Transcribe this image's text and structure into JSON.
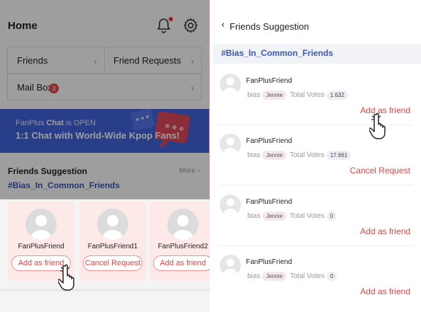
{
  "left": {
    "header": {
      "title": "Home",
      "bell_icon": "bell-icon",
      "settings_icon": "gear-icon"
    },
    "menu": {
      "friends": "Friends",
      "friend_requests": "Friend Requests",
      "mailbox": "Mail Box",
      "mailbox_badge": "3"
    },
    "banner": {
      "line1_prefix": "FanPlus ",
      "line1_bold": "Chat",
      "line1_suffix": " is OPEN",
      "line2": "1:1 Chat with World-Wide Kpop Fans!"
    },
    "friends_suggestion": {
      "title": "Friends Suggestion",
      "more": "More",
      "tag": "#Bias_In_Common_Friends"
    },
    "cards": [
      {
        "name": "FanPlusFriend",
        "button": "Add as friend"
      },
      {
        "name": "FanPlusFriend1",
        "button": "Cancel Request"
      },
      {
        "name": "FanPlusFriend2",
        "button": "Add as friend"
      }
    ]
  },
  "right": {
    "title": "Friends Suggestion",
    "tag": "#Bias_In_Common_Friends",
    "items": [
      {
        "name": "FanPlusFriend",
        "bias_label": "bias",
        "bias": "Jennie",
        "votes_label": "Total Votes",
        "votes": "1.632",
        "action": "Add as friend"
      },
      {
        "name": "FanPlusFriend",
        "bias_label": "bias",
        "bias": "Jennie",
        "votes_label": "Total Votes",
        "votes": "17.661",
        "action": "Cancel Request"
      },
      {
        "name": "FanPlusFriend",
        "bias_label": "bias",
        "bias": "Jennie",
        "votes_label": "Total Votes",
        "votes": "0",
        "action": "Add as friend"
      },
      {
        "name": "FanPlusFriend",
        "bias_label": "bias",
        "bias": "Jennie",
        "votes_label": "Total Votes",
        "votes": "0",
        "action": "Add as friend"
      }
    ]
  },
  "colors": {
    "accent_red": "#e74444",
    "tag_blue": "#3a56b8",
    "banner_blue": "#4264dd",
    "card_pink": "#fde9e7"
  }
}
